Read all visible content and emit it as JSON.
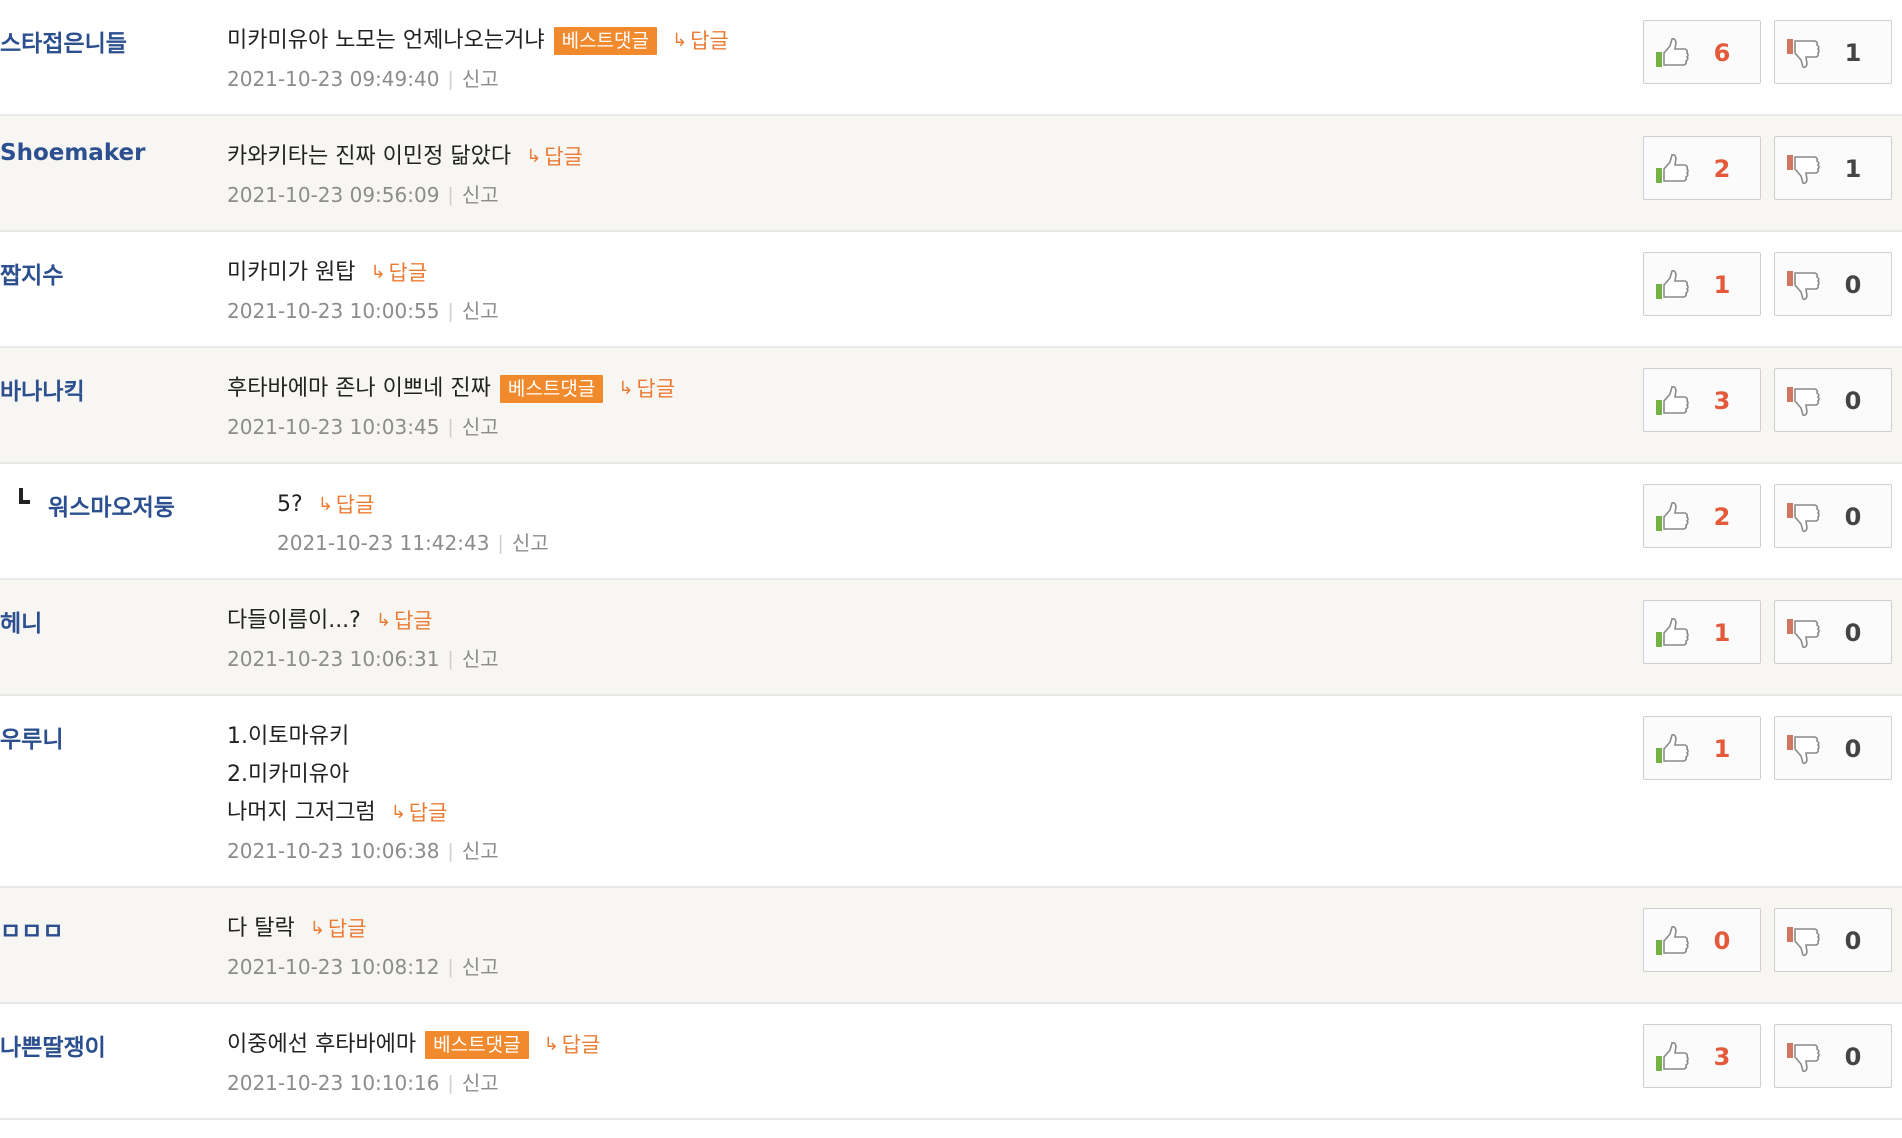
{
  "labels": {
    "best_badge": "베스트댓글",
    "reply": "답글",
    "report": "신고",
    "separator": "|"
  },
  "colors": {
    "nickname": "#2b4f8f",
    "best_badge_bg": "#f08a2c",
    "reply_link": "#ec7b33",
    "upvote_count": "#e4593a",
    "downvote_count": "#444444",
    "row_alt_bg": "#f7f6f3"
  },
  "icons": {
    "reply_arrow": "↳",
    "upvote": "thumbs-up-icon",
    "downvote": "thumbs-down-icon",
    "reply_marker": "reply-corner-icon"
  },
  "comments": [
    {
      "author": "스타접은니들",
      "lines": [
        "미카미유아 노모는 언제나오는거냐"
      ],
      "best": true,
      "timestamp": "2021-10-23 09:49:40",
      "upvotes": "6",
      "downvotes": "1"
    },
    {
      "author": "Shoemaker",
      "lines": [
        "카와키타는 진짜 이민정 닮았다"
      ],
      "best": false,
      "timestamp": "2021-10-23 09:56:09",
      "upvotes": "2",
      "downvotes": "1"
    },
    {
      "author": "짭지수",
      "lines": [
        "미카미가 원탑"
      ],
      "best": false,
      "timestamp": "2021-10-23 10:00:55",
      "upvotes": "1",
      "downvotes": "0"
    },
    {
      "author": "바나나킥",
      "lines": [
        "후타바에마 존나 이쁘네 진짜"
      ],
      "best": true,
      "timestamp": "2021-10-23 10:03:45",
      "upvotes": "3",
      "downvotes": "0"
    },
    {
      "author": "워스마오저둥",
      "lines": [
        "5?"
      ],
      "best": false,
      "is_reply": true,
      "timestamp": "2021-10-23 11:42:43",
      "upvotes": "2",
      "downvotes": "0"
    },
    {
      "author": "헤니",
      "lines": [
        "다들이름이...?"
      ],
      "best": false,
      "timestamp": "2021-10-23 10:06:31",
      "upvotes": "1",
      "downvotes": "0"
    },
    {
      "author": "우루니",
      "lines": [
        "1.이토마유키",
        "2.미카미유아",
        "나머지 그저그럼"
      ],
      "best": false,
      "timestamp": "2021-10-23 10:06:38",
      "upvotes": "1",
      "downvotes": "0"
    },
    {
      "author": "ㅁㅁㅁ",
      "lines": [
        "다 탈락"
      ],
      "best": false,
      "timestamp": "2021-10-23 10:08:12",
      "upvotes": "0",
      "downvotes": "0"
    },
    {
      "author": "나쁜딸쟁이",
      "lines": [
        "이중에선 후타바에마"
      ],
      "best": true,
      "timestamp": "2021-10-23 10:10:16",
      "upvotes": "3",
      "downvotes": "0"
    }
  ]
}
